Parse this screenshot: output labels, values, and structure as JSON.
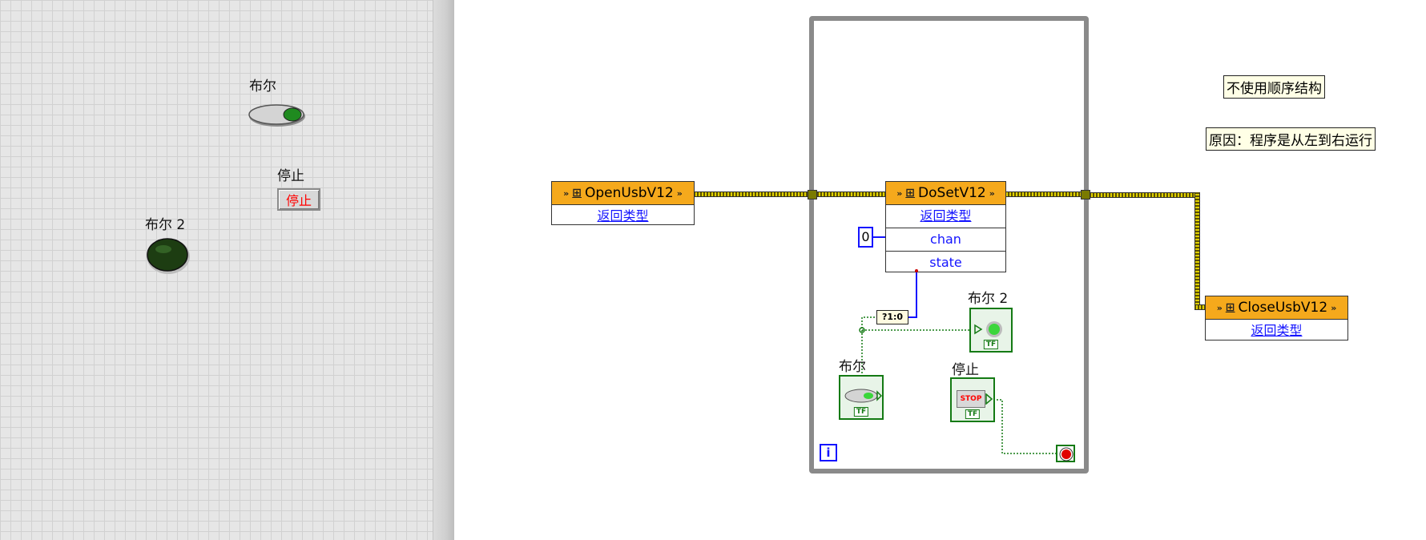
{
  "front_panel": {
    "bool_label": "布尔",
    "stop_label": "停止",
    "stop_button_text": "停止",
    "bool2_label": "布尔 2"
  },
  "block_diagram": {
    "open_node": {
      "name": "OpenUsbV12",
      "row": "返回类型"
    },
    "doset_node": {
      "name": "DoSetV12",
      "rows": [
        "返回类型",
        "chan",
        "state"
      ]
    },
    "close_node": {
      "name": "CloseUsbV12",
      "row": "返回类型"
    },
    "chan_constant": "0",
    "convert_node": "?1:0",
    "bool2_terminal_label": "布尔 2",
    "bool_terminal_label": "布尔",
    "stop_terminal_label": "停止",
    "stop_terminal_text": "STOP",
    "tf_tag": "TF",
    "iteration_icon": "i",
    "comment1": "不使用顺序结构",
    "comment2": "原因：程序是从左到右运行"
  },
  "colors": {
    "function_header": "#f5a91c",
    "error_wire": "#e0d000",
    "boolean_terminal": "#147a14",
    "stop_button_text": "#ff0000",
    "link_text": "#1414ff"
  }
}
